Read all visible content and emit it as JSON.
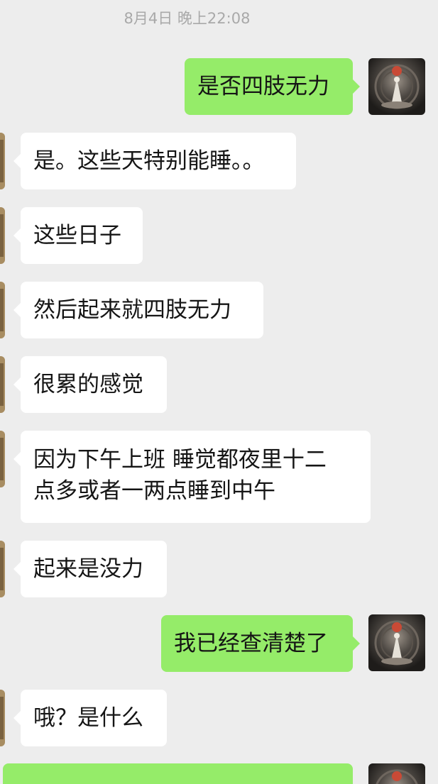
{
  "timestamp": "8月4日 晚上22:08",
  "messages": [
    {
      "side": "out",
      "text": "是否四肢无力"
    },
    {
      "side": "in",
      "text": "是。这些天特别能睡。。"
    },
    {
      "side": "in",
      "text": "这些日子"
    },
    {
      "side": "in",
      "text": "然后起来就四肢无力"
    },
    {
      "side": "in",
      "text": "很累的感觉"
    },
    {
      "side": "in",
      "line1": "因为下午上班 睡觉都夜里十二",
      "line2": "点多或者一两点睡到中午"
    },
    {
      "side": "in",
      "text": "起来是没力"
    },
    {
      "side": "out",
      "text": "我已经查清楚了"
    },
    {
      "side": "in",
      "text": "哦？是什么"
    },
    {
      "side": "out",
      "text": ""
    }
  ],
  "avatars": {
    "self_icon": "self-avatar-icon",
    "peer_icon": "peer-avatar-icon"
  },
  "colors": {
    "background": "#ededed",
    "incoming_bubble": "#ffffff",
    "outgoing_bubble": "#95ec69",
    "timestamp": "#a9a9a9"
  }
}
